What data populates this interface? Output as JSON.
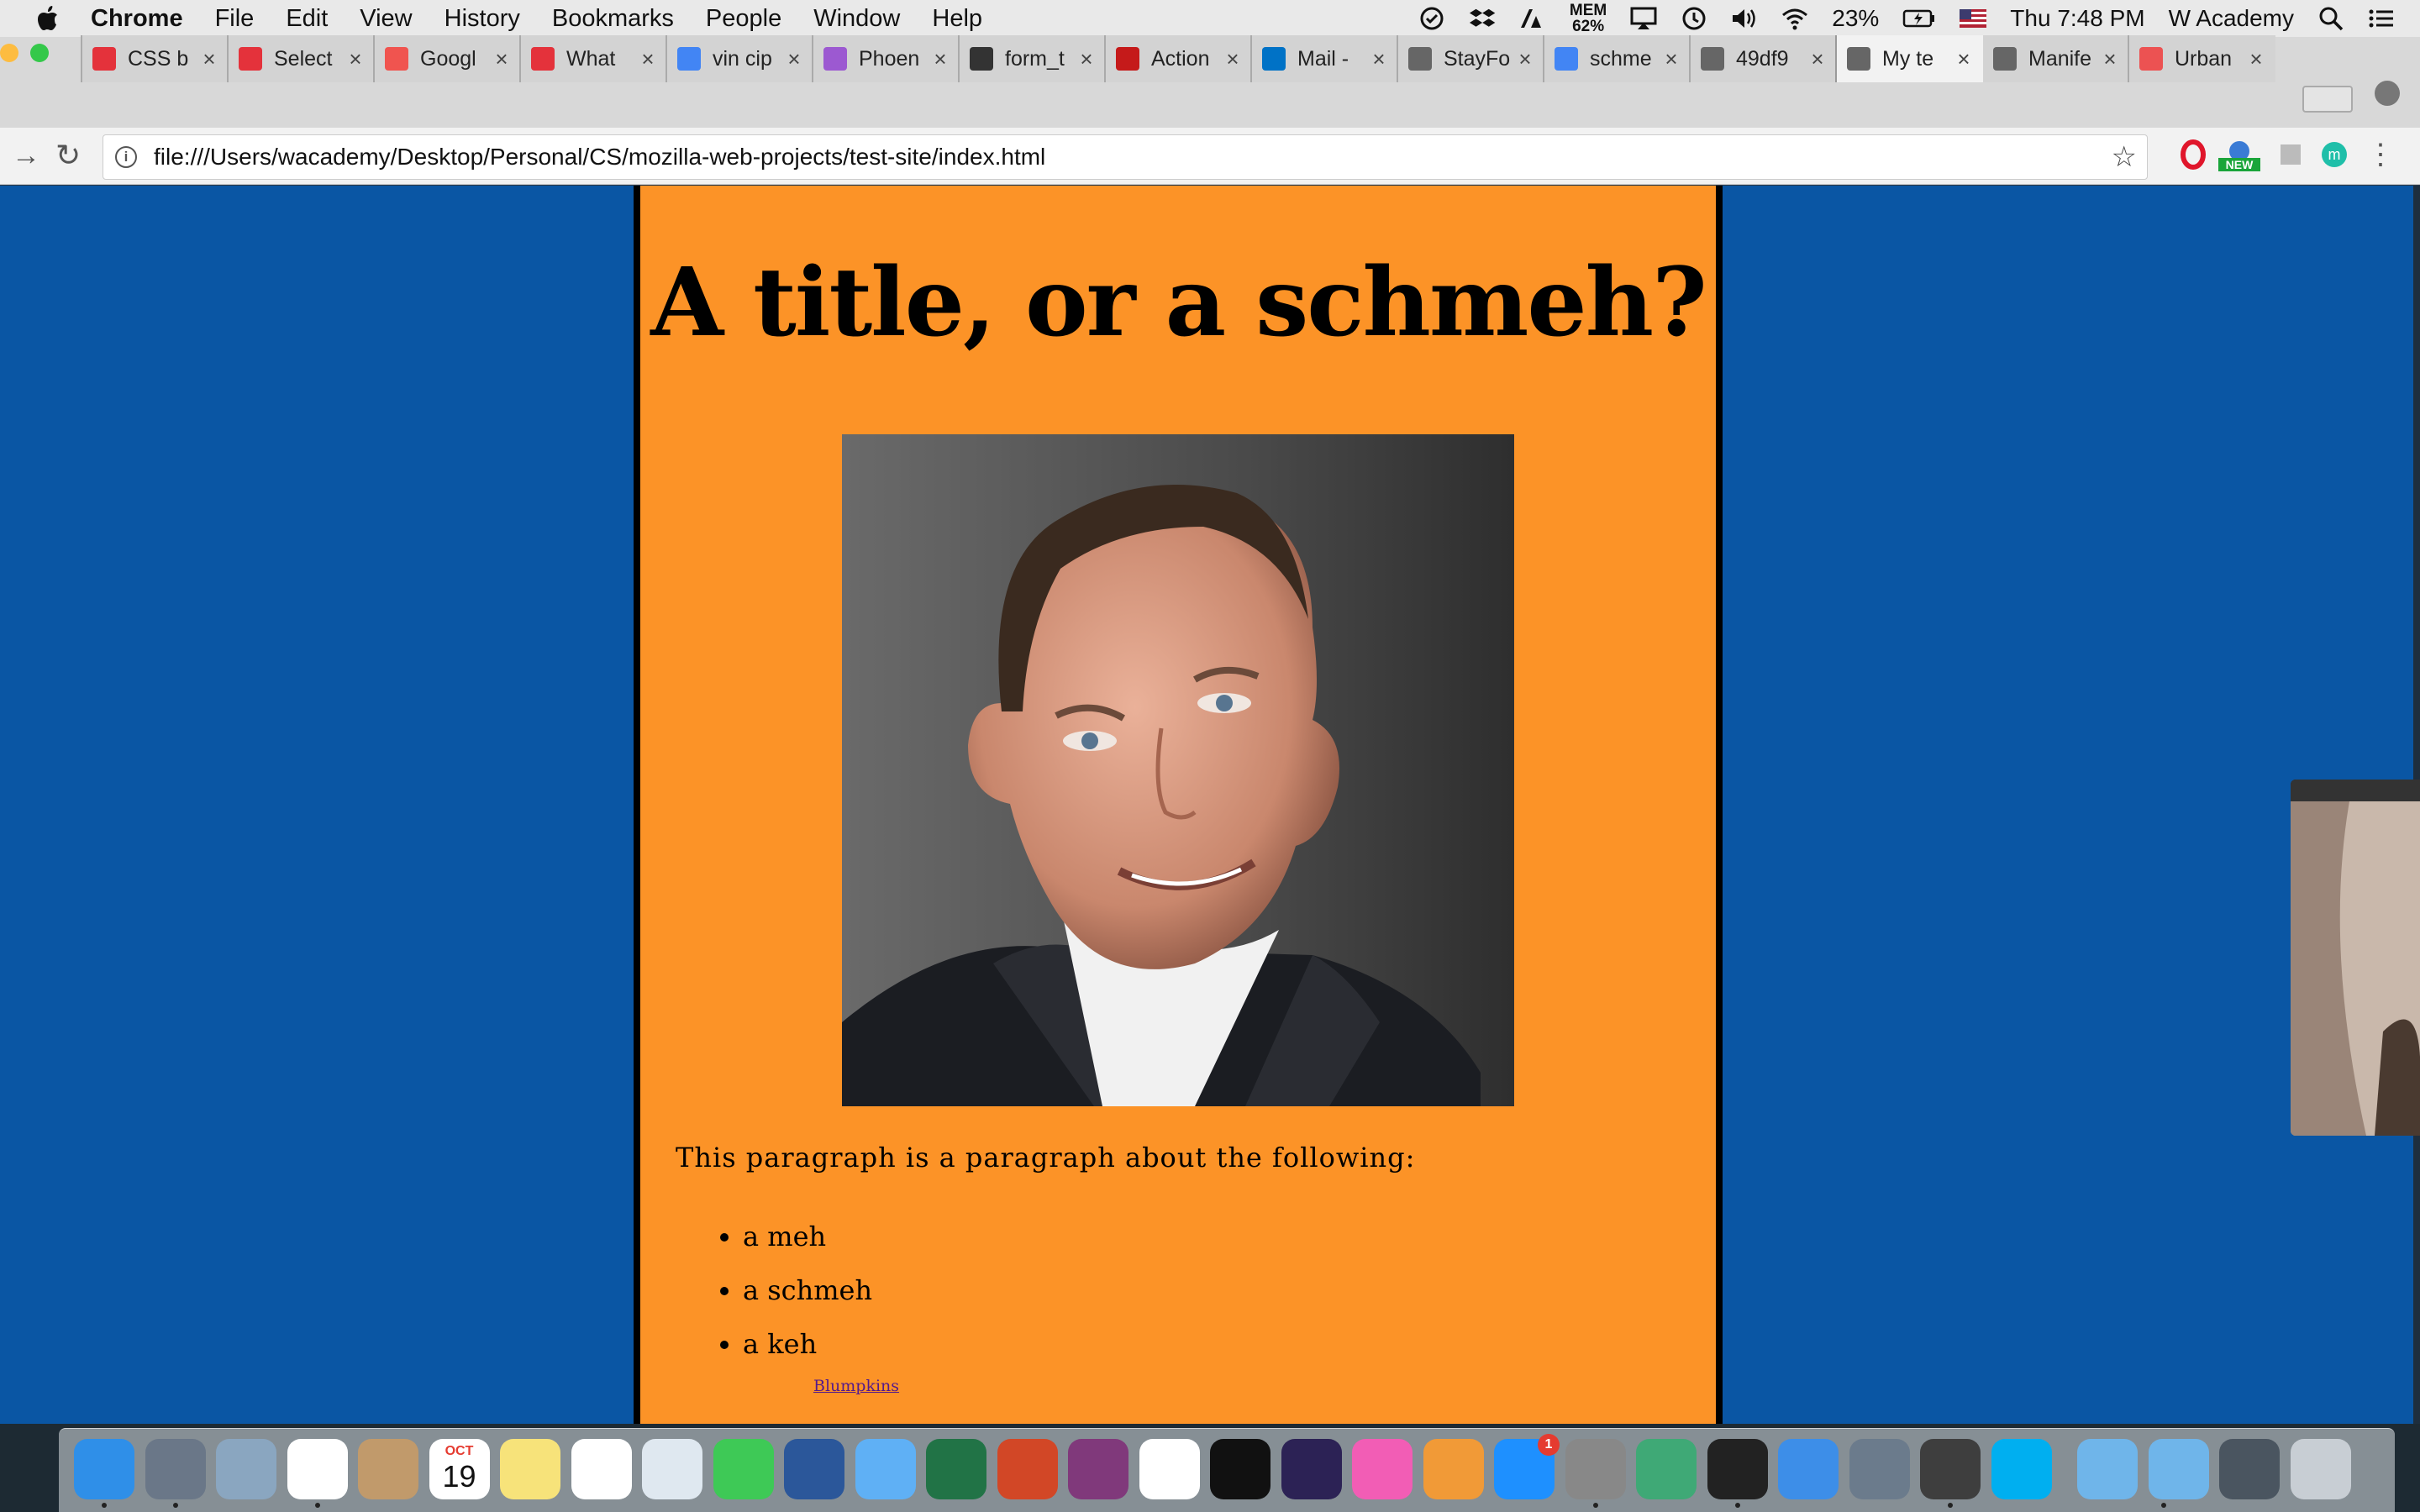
{
  "menubar": {
    "app_name": "Chrome",
    "items": [
      "File",
      "Edit",
      "View",
      "History",
      "Bookmarks",
      "People",
      "Window",
      "Help"
    ],
    "mem_label": "MEM",
    "mem_value": "62%",
    "battery": "23%",
    "datetime": "Thu 7:48 PM",
    "user": "W Academy"
  },
  "tabs": [
    {
      "title": "CSS b",
      "icon": "red-panda-icon",
      "color": "#e4323b"
    },
    {
      "title": "Select",
      "icon": "red-panda-icon",
      "color": "#e4323b"
    },
    {
      "title": "Googl",
      "icon": "f-icon",
      "color": "#f0544f"
    },
    {
      "title": "What",
      "icon": "red-panda-icon",
      "color": "#e4323b"
    },
    {
      "title": "vin cip",
      "icon": "google-icon",
      "color": "#4285f4"
    },
    {
      "title": "Phoen",
      "icon": "phoenix-icon",
      "color": "#9c59d1"
    },
    {
      "title": "form_t",
      "icon": "docs-icon",
      "color": "#333333"
    },
    {
      "title": "Action",
      "icon": "rails-icon",
      "color": "#c51a1a"
    },
    {
      "title": "Mail -",
      "icon": "outlook-icon",
      "color": "#0072c6"
    },
    {
      "title": "StayFo",
      "icon": "page-icon",
      "color": "#666666"
    },
    {
      "title": "schme",
      "icon": "google-icon",
      "color": "#4285f4"
    },
    {
      "title": "49df9",
      "icon": "page-icon",
      "color": "#666666"
    },
    {
      "title": "My te",
      "icon": "page-icon",
      "color": "#666666",
      "active": true
    },
    {
      "title": "Manife",
      "icon": "page-icon",
      "color": "#666666"
    },
    {
      "title": "Urban",
      "icon": "udemy-icon",
      "color": "#ec5252"
    }
  ],
  "toolbar": {
    "url": "file:///Users/wacademy/Desktop/Personal/CS/mozilla-web-projects/test-site/index.html",
    "ext_new_label": "NEW",
    "ext_m_label": "m"
  },
  "page": {
    "title": "A title, or a schmeh?",
    "paragraph": "This paragraph is a paragraph about the following:",
    "list": [
      "a meh",
      "a schmeh",
      "a keh"
    ],
    "link": "Blumpkins",
    "bg_color": "#0a56a4",
    "content_color": "#fc9327"
  },
  "dock": {
    "calendar_month": "OCT",
    "calendar_day": "19",
    "appstore_badge": "1",
    "apps": [
      "finder-icon",
      "launchpad-icon",
      "mail-eagle-icon",
      "chrome-icon",
      "contacts-icon",
      "calendar-icon",
      "notes-icon",
      "reminders-icon",
      "preview-icon",
      "facetime-icon",
      "word-icon",
      "messages-icon",
      "excel-icon",
      "powerpoint-icon",
      "onenote-icon",
      "photos-icon",
      "intellij-icon",
      "eclipse-icon",
      "itunes-icon",
      "ibooks-icon",
      "appstore-icon",
      "system-preferences-icon",
      "atom-icon",
      "terminal-icon",
      "safari-icon",
      "image-capture-icon",
      "sublime-icon",
      "skype-icon",
      "downloads-folder-icon",
      "applications-folder-icon",
      "screen-folder-icon",
      "trash-icon"
    ]
  }
}
